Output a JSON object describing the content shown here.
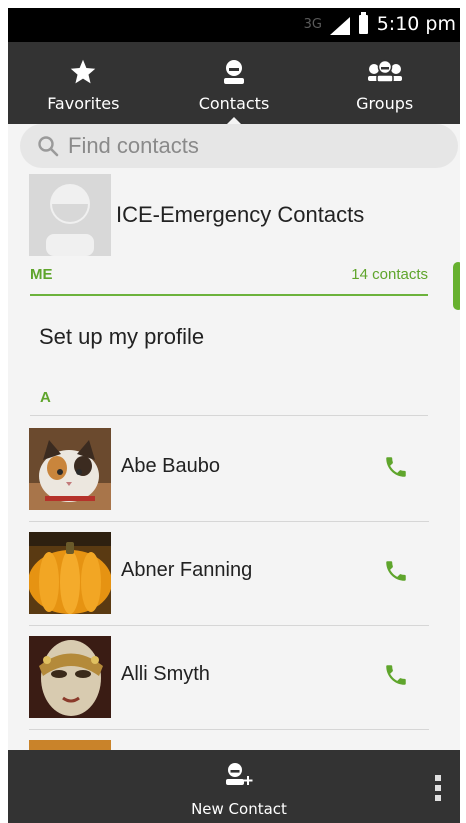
{
  "status_bar": {
    "network": "3G",
    "time": "5:10 pm"
  },
  "tabs": [
    {
      "label": "Favorites",
      "icon": "star-icon",
      "active": false
    },
    {
      "label": "Contacts",
      "icon": "person-icon",
      "active": true
    },
    {
      "label": "Groups",
      "icon": "group-icon",
      "active": false
    }
  ],
  "search": {
    "placeholder": "Find contacts"
  },
  "ice": {
    "label": "ICE-Emergency Contacts"
  },
  "me_section": {
    "header": "ME",
    "count": "14 contacts"
  },
  "profile": {
    "label": "Set up my profile"
  },
  "alpha_section": {
    "header": "A"
  },
  "contacts": [
    {
      "name": "Abe Baubo",
      "icon": "phone-icon"
    },
    {
      "name": "Abner Fanning",
      "icon": "phone-icon"
    },
    {
      "name": "Alli Smyth",
      "icon": "phone-icon"
    }
  ],
  "bottom_bar": {
    "new_contact_label": "New Contact",
    "more_icon": "overflow-menu-icon"
  },
  "colors": {
    "accent": "#5fa52c",
    "bar": "#333333",
    "background": "#f4f4f4"
  }
}
